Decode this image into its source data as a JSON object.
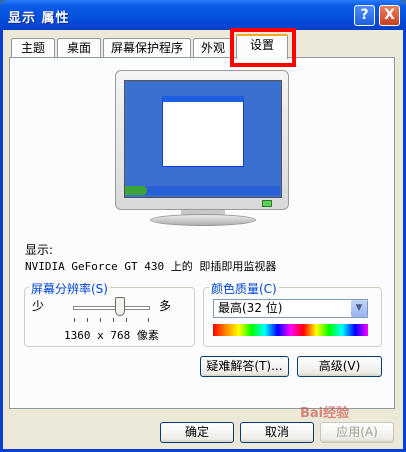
{
  "window": {
    "title": "显示 属性",
    "help_glyph": "?",
    "close_glyph": "X"
  },
  "tabs": [
    {
      "label": "主题",
      "active": false
    },
    {
      "label": "桌面",
      "active": false
    },
    {
      "label": "屏幕保护程序",
      "active": false
    },
    {
      "label": "外观",
      "active": false
    },
    {
      "label": "设置",
      "active": true
    }
  ],
  "display": {
    "label": "显示:",
    "value": "NVIDIA GeForce GT 430 上的 即插即用监视器"
  },
  "resolution": {
    "group_title": "屏幕分辨率(S)",
    "min_label": "少",
    "max_label": "多",
    "value_text": "1360 x 768 像素"
  },
  "color_quality": {
    "group_title": "颜色质量(C)",
    "selected": "最高(32 位)"
  },
  "buttons": {
    "troubleshoot": "疑难解答(T)...",
    "advanced": "高级(V)",
    "ok": "确定",
    "cancel": "取消",
    "apply": "应用(A)"
  },
  "watermark": "Bai经验"
}
